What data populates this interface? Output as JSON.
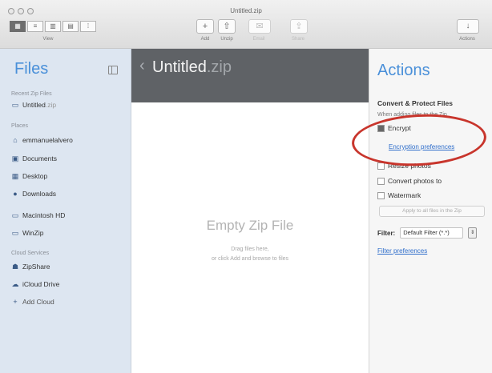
{
  "window": {
    "title": "Untitled.zip"
  },
  "toolbar": {
    "view_label": "View",
    "view_icons": [
      "grid-view-icon",
      "list-view-icon",
      "column-view-icon",
      "gallery-view-icon",
      "icon-size-icon"
    ],
    "buttons": [
      {
        "label": "Add",
        "icon": "plus-icon",
        "glyph": "+"
      },
      {
        "label": "Unzip",
        "icon": "unzip-icon",
        "glyph": "⇧"
      },
      {
        "label": "Email",
        "icon": "email-icon",
        "glyph": "✉"
      },
      {
        "label": "Share",
        "icon": "share-icon",
        "glyph": "⇪"
      }
    ],
    "actions_label": "Actions"
  },
  "sidebar": {
    "title": "Files",
    "recent_header": "Recent Zip Files",
    "recent_items": [
      {
        "name": "Untitled",
        "ext": ".zip"
      }
    ],
    "places_header": "Places",
    "places": [
      "emmanuelalvero",
      "Documents",
      "Desktop",
      "Downloads",
      "Macintosh HD",
      "WinZip"
    ],
    "cloud_header": "Cloud Services",
    "cloud": [
      "ZipShare",
      "iCloud Drive"
    ],
    "add_cloud": "Add Cloud"
  },
  "main": {
    "file_name": "Untitled",
    "file_ext": ".zip",
    "empty_title": "Empty Zip File",
    "empty_line1": "Drag files here,",
    "empty_line2": "or click Add and browse to files"
  },
  "actions": {
    "title": "Actions",
    "section": "Convert & Protect Files",
    "subtitle": "When adding files to the Zip",
    "encrypt": "Encrypt",
    "encryption_prefs": "Encryption preferences",
    "resize": "Resize photos",
    "convert": "Convert photos to",
    "watermark": "Watermark",
    "apply_btn": "Apply to all files in the Zip",
    "filter_label": "Filter:",
    "filter_value": "Default Filter (*.*)",
    "filter_prefs": "Filter preferences"
  },
  "colors": {
    "accent": "#4a90d9",
    "annotation": "#c8352c",
    "header": "#5f6266"
  }
}
